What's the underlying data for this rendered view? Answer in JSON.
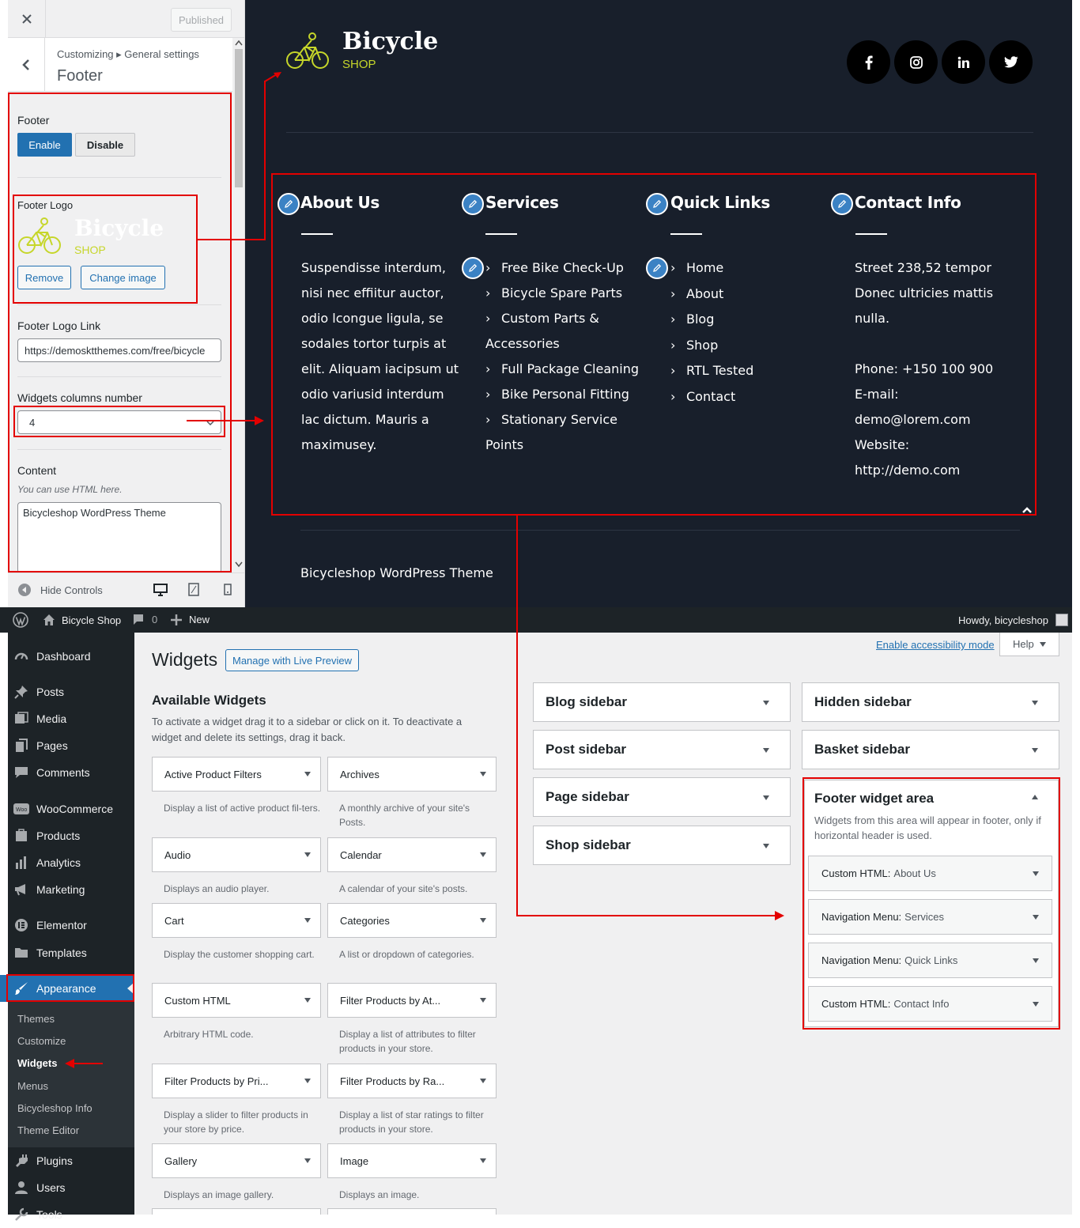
{
  "customizer": {
    "published_label": "Published",
    "breadcrumb": "Customizing ▸ General settings",
    "section_title": "Footer",
    "footer_label": "Footer",
    "enable_label": "Enable",
    "disable_label": "Disable",
    "footer_logo_label": "Footer Logo",
    "logo_title": "Bicycle",
    "logo_subtitle": "SHOP",
    "remove_label": "Remove",
    "change_image_label": "Change image",
    "logo_link_label": "Footer Logo Link",
    "logo_link_value": "https://demosktthemes.com/free/bicycle",
    "widgets_columns_label": "Widgets columns number",
    "widgets_columns_value": "4",
    "content_label": "Content",
    "content_hint": "You can use HTML here.",
    "content_value": "Bicycleshop WordPress Theme",
    "hide_controls_label": "Hide Controls"
  },
  "preview": {
    "logo_title": "Bicycle",
    "logo_subtitle": "SHOP",
    "columns": {
      "about": {
        "heading": "About Us",
        "lines": [
          "Suspendisse interdum,",
          "nisi nec effiitur auctor,",
          "odio lcongue ligula, se",
          "sodales tortor turpis at",
          "elit. Aliquam iacipsum ut",
          "odio variusid interdum",
          "lac dictum. Mauris a",
          "maximusey."
        ]
      },
      "services": {
        "heading": "Services",
        "items": [
          "Free Bike Check-Up",
          "Bicycle Spare Parts",
          "Custom Parts &",
          "Accessories",
          "Full Package Cleaning",
          "Bike Personal Fitting",
          "Stationary Service",
          "Points"
        ]
      },
      "quick": {
        "heading": "Quick Links",
        "items": [
          "Home",
          "About",
          "Blog",
          "Shop",
          "RTL Tested",
          "Contact"
        ]
      },
      "contact": {
        "heading": "Contact Info",
        "lines": [
          "Street 238,52 tempor",
          "Donec ultricies mattis",
          "nulla.",
          "",
          "Phone: +150 100 900",
          "E-mail:",
          "demo@lorem.com",
          "Website:",
          "http://demo.com"
        ]
      }
    },
    "copyright": "Bicycleshop WordPress Theme"
  },
  "adminbar": {
    "site_name": "Bicycle Shop",
    "comments_count": "0",
    "new_label": "New",
    "howdy": "Howdy, bicycleshop"
  },
  "menu": {
    "dashboard": "Dashboard",
    "posts": "Posts",
    "media": "Media",
    "pages": "Pages",
    "comments": "Comments",
    "woocommerce": "WooCommerce",
    "products": "Products",
    "analytics": "Analytics",
    "marketing": "Marketing",
    "elementor": "Elementor",
    "templates": "Templates",
    "appearance": "Appearance",
    "sub": {
      "themes": "Themes",
      "customize": "Customize",
      "widgets": "Widgets",
      "menus": "Menus",
      "info": "Bicycleshop Info",
      "editor": "Theme Editor"
    },
    "plugins": "Plugins",
    "users": "Users",
    "tools": "Tools"
  },
  "widgets_page": {
    "title": "Widgets",
    "live_preview_label": "Manage with Live Preview",
    "accessibility_link": "Enable accessibility mode",
    "help_label": "Help",
    "available_title": "Available Widgets",
    "available_desc": "To activate a widget drag it to a sidebar or click on it. To deactivate a widget and delete its settings, drag it back.",
    "available": [
      {
        "name": "Active Product Filters",
        "desc": "Display a list of active product fil-ters."
      },
      {
        "name": "Archives",
        "desc": "A monthly archive of your site's Posts."
      },
      {
        "name": "Audio",
        "desc": "Displays an audio player."
      },
      {
        "name": "Calendar",
        "desc": "A calendar of your site's posts."
      },
      {
        "name": "Cart",
        "desc": "Display the customer shopping cart."
      },
      {
        "name": "Categories",
        "desc": "A list or dropdown of categories."
      },
      {
        "name": "Custom HTML",
        "desc": "Arbitrary HTML code."
      },
      {
        "name": "Filter Products by At...",
        "desc": "Display a list of attributes to filter products in your store."
      },
      {
        "name": "Filter Products by Pri...",
        "desc": "Display a slider to filter products in your store by price."
      },
      {
        "name": "Filter Products by Ra...",
        "desc": "Display a list of star ratings to filter products in your store."
      },
      {
        "name": "Gallery",
        "desc": "Displays an image gallery."
      },
      {
        "name": "Image",
        "desc": "Displays an image."
      }
    ],
    "sidebars_left": [
      "Blog sidebar",
      "Post sidebar",
      "Page sidebar",
      "Shop sidebar"
    ],
    "sidebars_right": [
      "Hidden sidebar",
      "Basket sidebar"
    ],
    "footer_area": {
      "title": "Footer widget area",
      "desc": "Widgets from this area will appear in footer, only if horizontal header is used.",
      "widgets": [
        {
          "type": "Custom HTML:",
          "name": "About Us"
        },
        {
          "type": "Navigation Menu:",
          "name": "Services"
        },
        {
          "type": "Navigation Menu:",
          "name": "Quick Links"
        },
        {
          "type": "Custom HTML:",
          "name": "Contact Info"
        }
      ]
    }
  },
  "colors": {
    "accent": "#2271b1",
    "annotation": "#e30000",
    "footer_bg": "#181f2b",
    "logo": "#c6d62a"
  }
}
